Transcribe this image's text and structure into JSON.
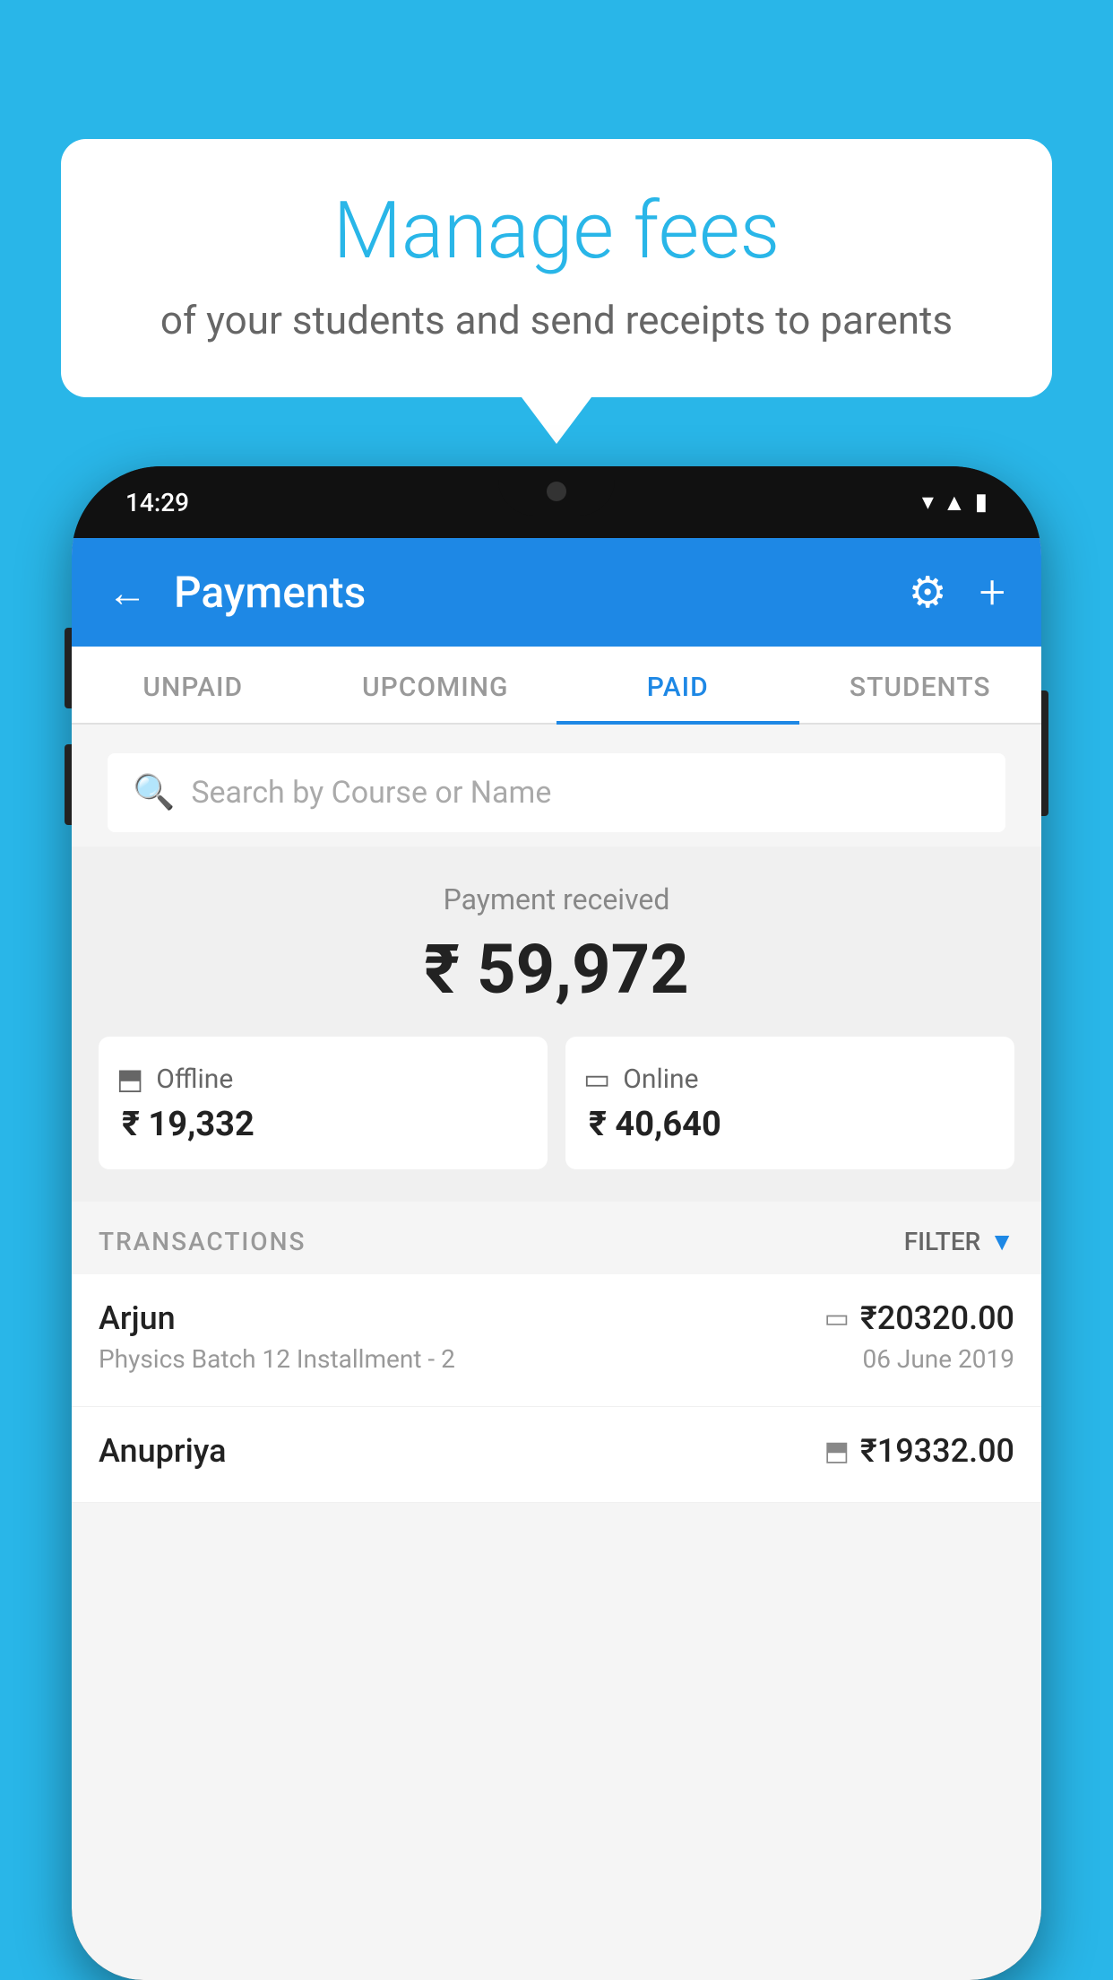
{
  "background_color": "#29b6e8",
  "bubble": {
    "title": "Manage fees",
    "subtitle": "of your students and send receipts to parents"
  },
  "status_bar": {
    "time": "14:29",
    "icons": [
      "wifi",
      "signal",
      "battery"
    ]
  },
  "header": {
    "title": "Payments",
    "back_label": "←",
    "gear_label": "⚙",
    "plus_label": "+"
  },
  "tabs": [
    {
      "label": "UNPAID",
      "active": false
    },
    {
      "label": "UPCOMING",
      "active": false
    },
    {
      "label": "PAID",
      "active": true
    },
    {
      "label": "STUDENTS",
      "active": false
    }
  ],
  "search": {
    "placeholder": "Search by Course or Name"
  },
  "payment_summary": {
    "label": "Payment received",
    "total": "₹ 59,972",
    "offline": {
      "icon": "offline",
      "label": "Offline",
      "amount": "₹ 19,332"
    },
    "online": {
      "icon": "online",
      "label": "Online",
      "amount": "₹ 40,640"
    }
  },
  "transactions_section": {
    "label": "TRANSACTIONS",
    "filter_label": "FILTER"
  },
  "transactions": [
    {
      "name": "Arjun",
      "amount": "₹20320.00",
      "detail": "Physics Batch 12 Installment - 2",
      "date": "06 June 2019",
      "payment_type": "online"
    },
    {
      "name": "Anupriya",
      "amount": "₹19332.00",
      "detail": "",
      "date": "",
      "payment_type": "offline"
    }
  ]
}
